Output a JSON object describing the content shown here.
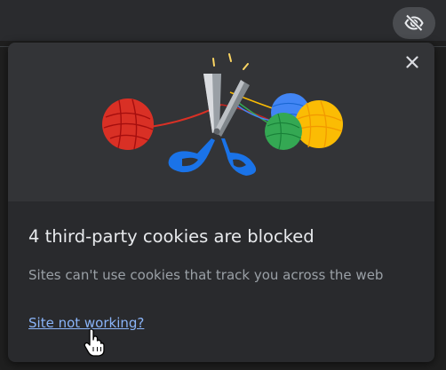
{
  "toolbar": {
    "tracking_icon": "eye-off-icon",
    "icon_bg": "#4a4c50"
  },
  "popup": {
    "close_icon": "close-icon",
    "illustration": "scissors-cutting-yarn-balls-illustration",
    "title": "4 third-party cookies are blocked",
    "subtitle": "Sites can't use cookies that track you across the web",
    "link_label": "Site not working?",
    "colors": {
      "background": "#292a2d",
      "banner": "#333437",
      "title": "#e8eaed",
      "subtitle": "#9aa0a6",
      "link": "#8ab4f8"
    }
  },
  "cursor": "hand-pointer-icon"
}
